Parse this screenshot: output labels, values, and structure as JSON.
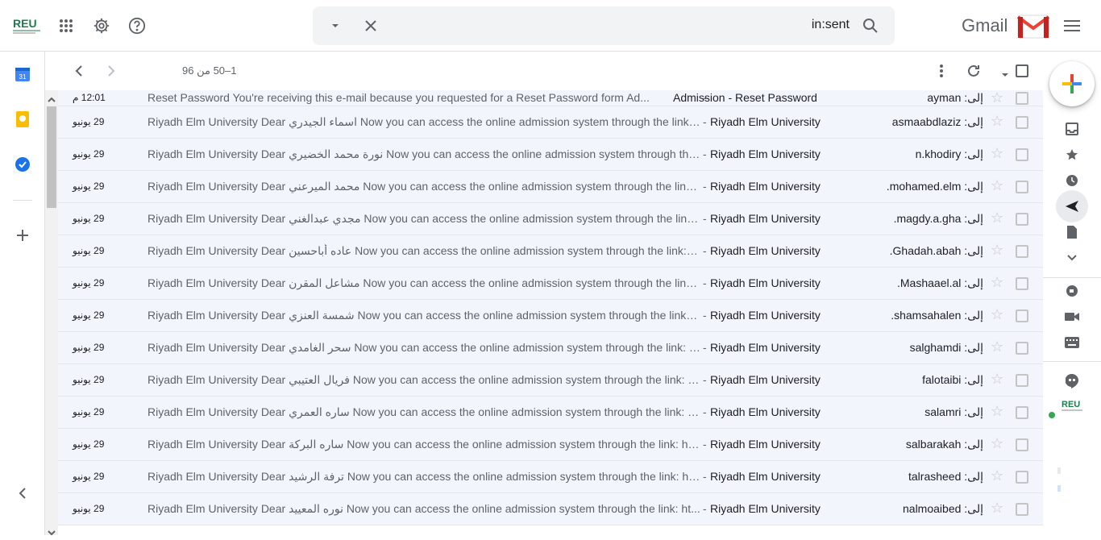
{
  "header": {
    "brand_logo": "REU",
    "search_value": "in:sent",
    "gmail_label": "Gmail"
  },
  "toolbar": {
    "pager_text": "1–50 من 96"
  },
  "left_rail": {
    "calendar_day": "31"
  },
  "emails": [
    {
      "date": "12:01 م",
      "snippet": "Reset Password You're receiving this e-mail because you requested for a Reset Password form Ad...",
      "subject": "Admission - Reset Password",
      "to": "إلى: ayman"
    },
    {
      "date": "29 يونيو",
      "snippet": "Riyadh Elm University Dear اسماء الجيدري Now you can access the online admission system through the link: ...",
      "subject": "Riyadh Elm University",
      "to": "إلى: asmaabdlaziz"
    },
    {
      "date": "29 يونيو",
      "snippet": "Riyadh Elm University Dear نورة محمد الخضيري Now you can access the online admission system through the ...",
      "subject": "Riyadh Elm University",
      "to": "إلى: n.khodiry"
    },
    {
      "date": "29 يونيو",
      "snippet": "Riyadh Elm University Dear محمد الميرعني Now you can access the online admission system through the link:...",
      "subject": "Riyadh Elm University",
      "to": "إلى: mohamed.elm."
    },
    {
      "date": "29 يونيو",
      "snippet": "Riyadh Elm University Dear مجدي عبدالغني Now you can access the online admission system through the link:...",
      "subject": "Riyadh Elm University",
      "to": "إلى: magdy.a.gha."
    },
    {
      "date": "29 يونيو",
      "snippet": "Riyadh Elm University Dear عاده أباحسين Now you can access the online admission system through the link: h...",
      "subject": "Riyadh Elm University",
      "to": "إلى: Ghadah.abah."
    },
    {
      "date": "29 يونيو",
      "snippet": "Riyadh Elm University Dear مشاعل المقرن Now you can access the online admission system through the link: ...",
      "subject": "Riyadh Elm University",
      "to": "إلى: Mashaael.al."
    },
    {
      "date": "29 يونيو",
      "snippet": "Riyadh Elm University Dear شمسة العنزي Now you can access the online admission system through the link: h...",
      "subject": "Riyadh Elm University",
      "to": "إلى: shamsahalen."
    },
    {
      "date": "29 يونيو",
      "snippet": "Riyadh Elm University Dear سحر الغامدي Now you can access the online admission system through the link: h...",
      "subject": "Riyadh Elm University",
      "to": "إلى: salghamdi"
    },
    {
      "date": "29 يونيو",
      "snippet": "Riyadh Elm University Dear فريال العتيبي Now you can access the online admission system through the link: h...",
      "subject": "Riyadh Elm University",
      "to": "إلى: falotaibi"
    },
    {
      "date": "29 يونيو",
      "snippet": "Riyadh Elm University Dear ساره العمري Now you can access the online admission system through the link: h...",
      "subject": "Riyadh Elm University",
      "to": "إلى: salamri"
    },
    {
      "date": "29 يونيو",
      "snippet": "Riyadh Elm University Dear ساره البركة Now you can access the online admission system through the link: ht...",
      "subject": "Riyadh Elm University",
      "to": "إلى: salbarakah"
    },
    {
      "date": "29 يونيو",
      "snippet": "Riyadh Elm University Dear ترفة الرشيد Now you can access the online admission system through the link: ht...",
      "subject": "Riyadh Elm University",
      "to": "إلى: talrasheed"
    },
    {
      "date": "29 يونيو",
      "snippet": "Riyadh Elm University Dear نوره المعييد Now you can access the online admission system through the link: ht...",
      "subject": "Riyadh Elm University",
      "to": "إلى: nalmoaibed"
    }
  ]
}
